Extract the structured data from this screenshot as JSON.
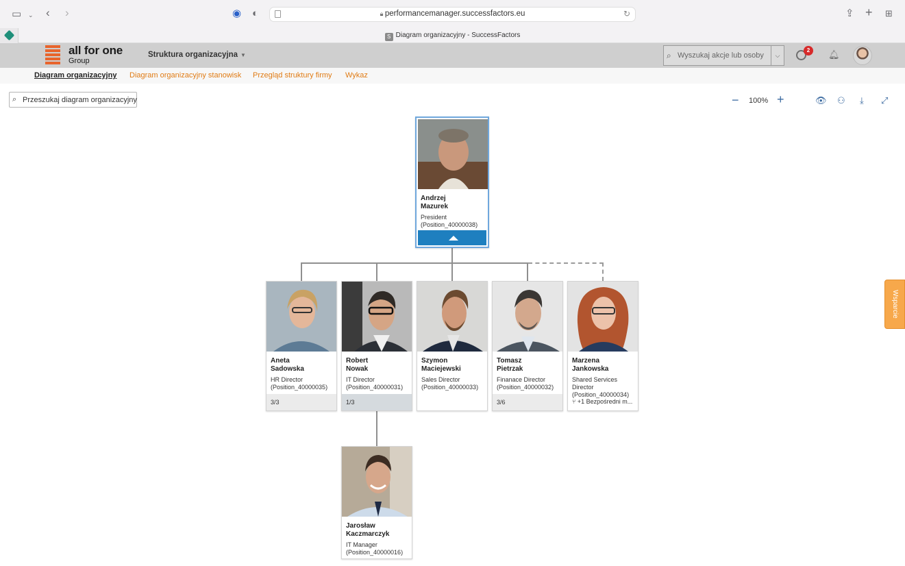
{
  "browser": {
    "url": "performancemanager.successfactors.eu",
    "tab_title": "Diagram organizacyjny - SuccessFactors",
    "tab_favicon_letter": "S"
  },
  "header": {
    "logo_main": "all for one",
    "logo_sub": "Group",
    "module": "Struktura organizacyjna",
    "search_placeholder": "Wyszukaj akcje lub osoby",
    "todo_badge": "2"
  },
  "subnav": {
    "items": [
      {
        "label": "Diagram organizacyjny",
        "active": true
      },
      {
        "label": "Diagram organizacyjny stanowisk",
        "active": false
      },
      {
        "label": "Przegląd struktury firmy",
        "active": false
      },
      {
        "label": "Wykaz",
        "active": false
      }
    ]
  },
  "toolbar": {
    "search_placeholder": "Przeszukaj diagram organizacyjny",
    "zoom": "100%"
  },
  "org": {
    "root": {
      "name_1": "Andrzej",
      "name_2": "Mazurek",
      "title_1": "President",
      "title_2": "(Position_40000038)"
    },
    "directs": [
      {
        "name_1": "Aneta",
        "name_2": "Sadowska",
        "title_1": "HR Director",
        "title_2": "(Position_40000035)",
        "title_3": "",
        "footer": "3/3"
      },
      {
        "name_1": "Robert",
        "name_2": "Nowak",
        "title_1": "IT Director",
        "title_2": "(Position_40000031)",
        "title_3": "",
        "footer": "1/3"
      },
      {
        "name_1": "Szymon",
        "name_2": "Maciejewski",
        "title_1": "Sales Director",
        "title_2": "(Position_40000033)",
        "title_3": "",
        "footer": ""
      },
      {
        "name_1": "Tomasz",
        "name_2": "Pietrzak",
        "title_1": "Finanace Director",
        "title_2": "(Position_40000032)",
        "title_3": "",
        "footer": "3/6"
      },
      {
        "name_1": "Marzena",
        "name_2": "Jankowska",
        "title_1": "Shared Services",
        "title_2": "Director",
        "title_3": "(Position_40000034)",
        "footer": "+1 Bezpośredni m..."
      }
    ],
    "sub": {
      "name_1": "Jarosław",
      "name_2": "Kaczmarczyk",
      "title_1": "IT Manager",
      "title_2": "(Position_40000016)"
    }
  },
  "support_label": "Wsparcie",
  "colors": {
    "accent_orange": "#e07b14",
    "highlight_blue": "#1e7fbf",
    "badge_red": "#d72a2a",
    "support_orange": "#f7a84b"
  }
}
